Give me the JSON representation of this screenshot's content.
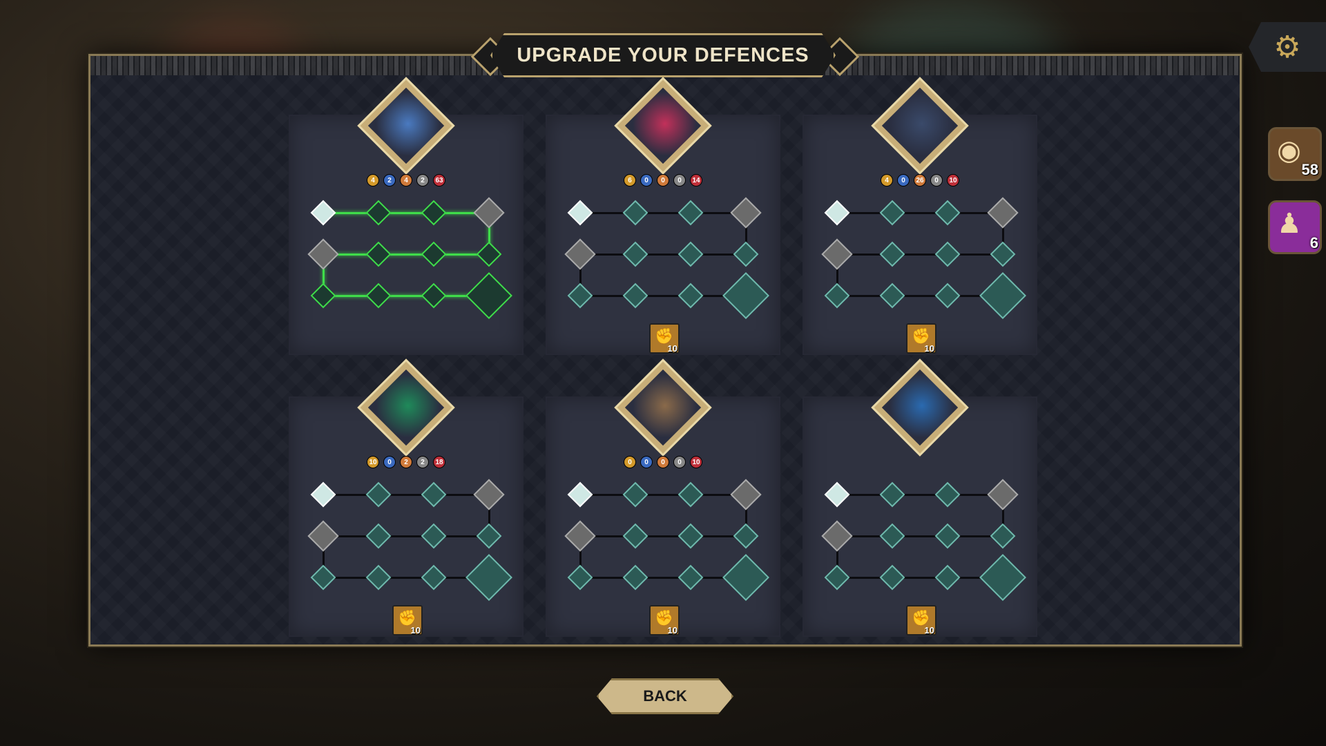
{
  "title": "UPGRADE YOUR DEFENCES",
  "back_label": "BACK",
  "resources": {
    "coins": {
      "icon": "coin-stack-icon",
      "count": "58"
    },
    "hero": {
      "icon": "hero-figure-icon",
      "count": "6"
    }
  },
  "settings": {
    "icon": "gear-icon"
  },
  "cards": [
    {
      "name": "blue-crystal-tower",
      "stats": [
        "4",
        "2",
        "4",
        "2",
        "63"
      ],
      "cost": null
    },
    {
      "name": "red-crown-tower",
      "stats": [
        "6",
        "0",
        "0",
        "0",
        "14"
      ],
      "cost": "10"
    },
    {
      "name": "golden-orb-fort",
      "stats": [
        "4",
        "0",
        "26",
        "0",
        "10"
      ],
      "cost": "10"
    },
    {
      "name": "green-crystal-altar",
      "stats": [
        "10",
        "0",
        "2",
        "2",
        "18"
      ],
      "cost": "10"
    },
    {
      "name": "barrel-trap",
      "stats": [
        "0",
        "0",
        "0",
        "0",
        "10"
      ],
      "cost": "10"
    },
    {
      "name": "blue-spike-trap",
      "stats": [],
      "cost": "10"
    }
  ],
  "colors": {
    "accent_gold": "#b9a26d",
    "active_path": "#3fdc4a",
    "panel": "#1b1e28",
    "card": "#2f3240"
  }
}
